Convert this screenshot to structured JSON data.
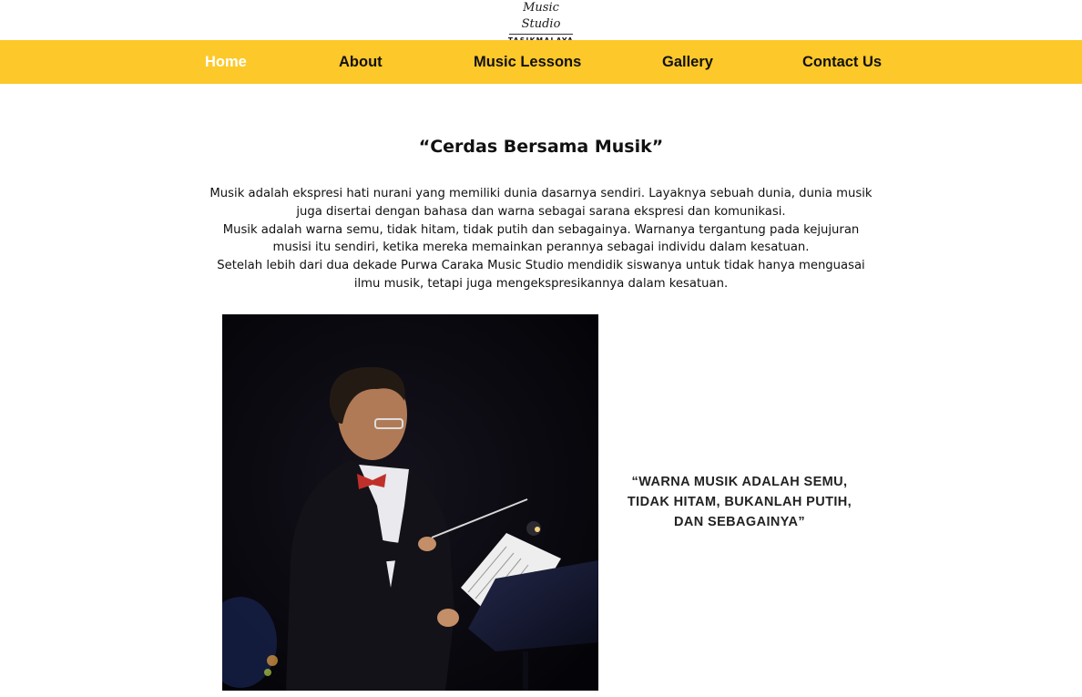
{
  "brand": {
    "script_name": "Music Studio",
    "city": "TASIKMALAYA"
  },
  "nav": {
    "items": [
      {
        "label": "Home",
        "active": true
      },
      {
        "label": "About",
        "active": false
      },
      {
        "label": "Music Lessons",
        "active": false
      },
      {
        "label": "Gallery",
        "active": false
      },
      {
        "label": "Contact Us",
        "active": false
      }
    ],
    "bar_color": "#fdc82a"
  },
  "main": {
    "headline": "“Cerdas Bersama Musik”",
    "paragraphs": [
      "Musik adalah ekspresi hati nurani yang memiliki dunia dasarnya sendiri. Layaknya sebuah dunia, dunia musik juga disertai dengan bahasa dan warna sebagai sarana ekspresi dan komunikasi.",
      "Musik adalah warna semu, tidak hitam, tidak putih dan sebagainya. Warnanya tergantung pada kejujuran musisi itu sendiri, ketika mereka memainkan perannya sebagai individu dalam kesatuan.",
      "Setelah lebih dari dua dekade Purwa Caraka Music Studio mendidik siswanya untuk tidak hanya menguasai ilmu musik, tetapi juga mengekspresikannya dalam kesatuan."
    ],
    "quote_lines": [
      "“WARNA MUSIK ADALAH SEMU,",
      "TIDAK HITAM, BUKANLAH PUTIH,",
      "DAN SEBAGAINYA”"
    ]
  }
}
